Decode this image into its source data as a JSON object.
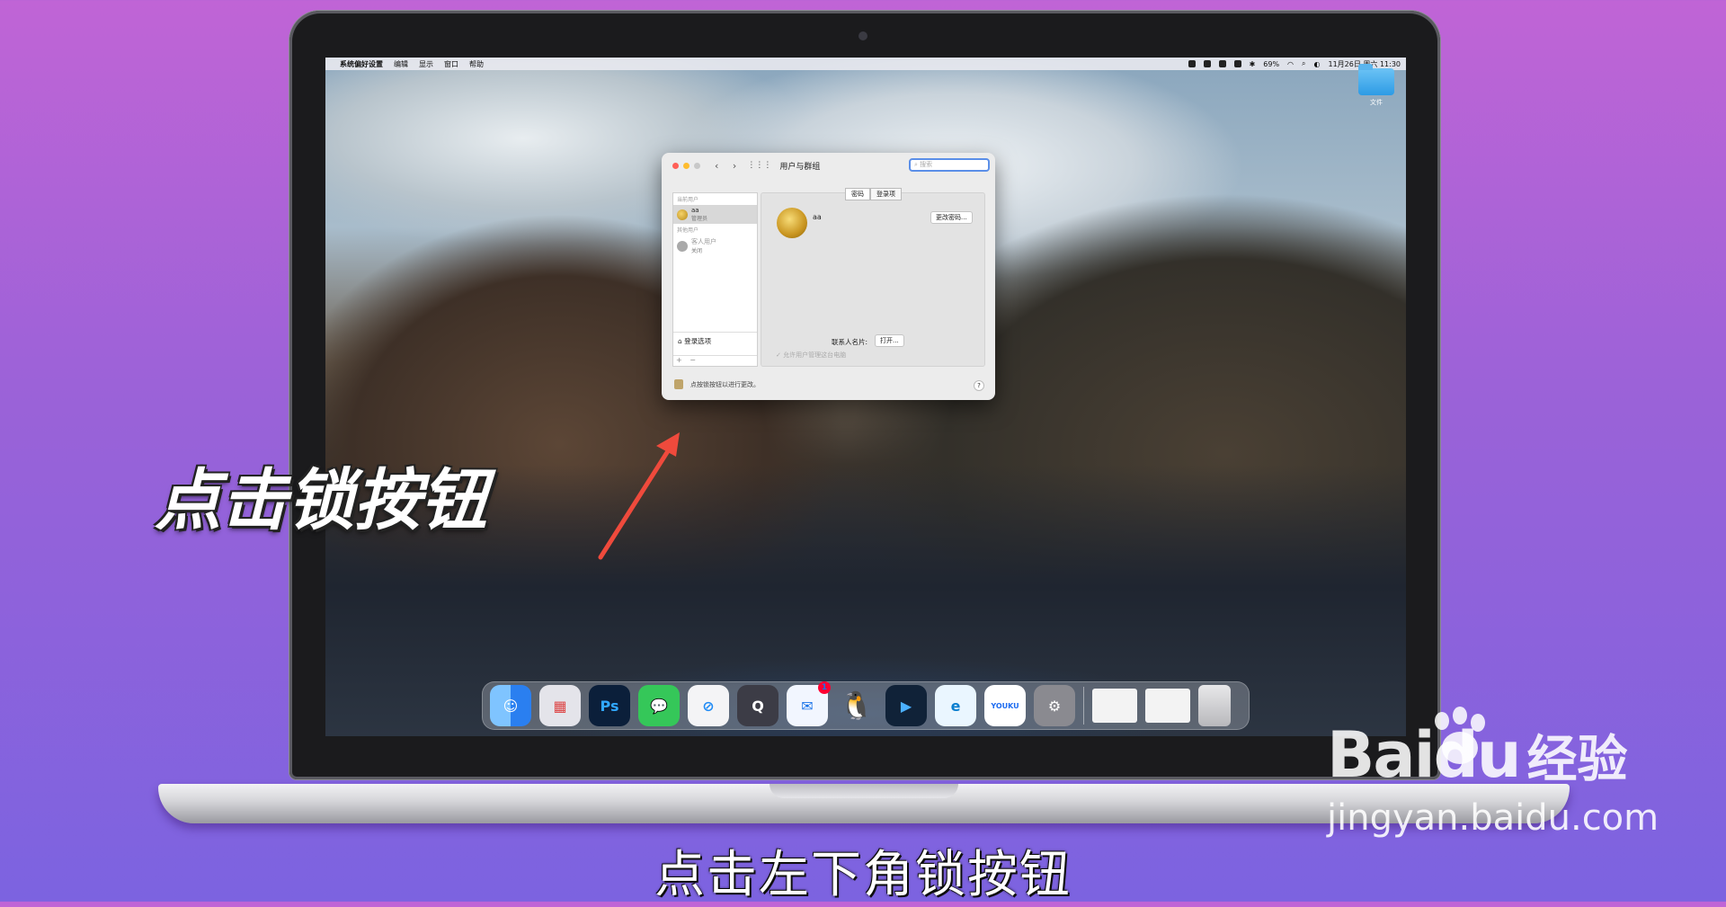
{
  "menubar": {
    "app_name": "系统偏好设置",
    "menus": [
      "编辑",
      "显示",
      "窗口",
      "帮助"
    ],
    "battery": "69%",
    "datetime": "11月26日 周六 11:30"
  },
  "desktop": {
    "folder_label": "文件"
  },
  "prefs_window": {
    "title": "用户与群组",
    "search_placeholder": "搜索",
    "sidebar": {
      "current_users_label": "当前用户",
      "current_user_name": "aa",
      "current_user_role": "管理员",
      "other_users_label": "其他用户",
      "guest_name": "客人用户",
      "guest_status": "关闭",
      "login_options": "登录选项",
      "add": "+",
      "remove": "−"
    },
    "tabs": [
      "密码",
      "登录项"
    ],
    "user_display_name": "aa",
    "change_password_button": "更改密码...",
    "contact_card_label": "联系人名片:",
    "open_button": "打开...",
    "allow_admin_label": "允许用户管理这台电脑",
    "lock_text": "点按锁按钮以进行更改。",
    "help": "?"
  },
  "dock": {
    "apps": [
      {
        "name": "Finder",
        "label": "",
        "color": "#2a8cf0"
      },
      {
        "name": "Launchpad",
        "label": "",
        "color": "#e7e7ea"
      },
      {
        "name": "Photoshop",
        "label": "Ps",
        "color": "#0b1f3a"
      },
      {
        "name": "Messages",
        "label": "",
        "color": "#35c759"
      },
      {
        "name": "Safari",
        "label": "",
        "color": "#1e8af5"
      },
      {
        "name": "QuickTime",
        "label": "",
        "color": "#3a3a44"
      },
      {
        "name": "Mail",
        "label": "",
        "color": "#1a73e8",
        "badge": "1"
      },
      {
        "name": "QQ",
        "label": "",
        "color": "#111"
      },
      {
        "name": "Video",
        "label": "",
        "color": "#102238"
      },
      {
        "name": "Edge",
        "label": "",
        "color": "#0a7ecf"
      },
      {
        "name": "Youku",
        "label": "YOUKU",
        "color": "#ffffff"
      },
      {
        "name": "System Preferences",
        "label": "",
        "color": "#8a8a90"
      }
    ]
  },
  "overlay": {
    "caption": "点击锁按钮",
    "subtitle": "点击左下角锁按钮",
    "watermark_logo": "Baidu",
    "watermark_cn": "经验",
    "watermark_url": "jingyan.baidu.com"
  }
}
